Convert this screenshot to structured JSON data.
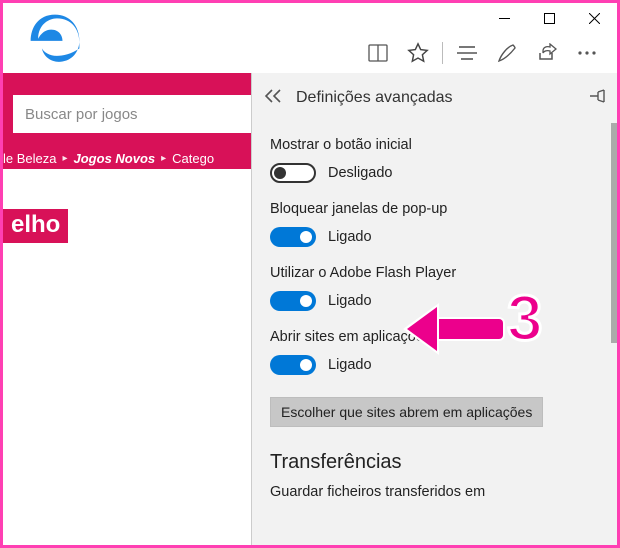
{
  "toolbar_icons": {
    "reading_list": "reading-list-icon",
    "favorites": "star-icon",
    "hub": "lines-icon",
    "notes": "pen-icon",
    "share": "share-icon",
    "more": "more-icon"
  },
  "page": {
    "search_placeholder": "Buscar por jogos",
    "nav": {
      "item1": "le Beleza",
      "item2": "Jogos Novos",
      "item3": "Catego"
    },
    "badge": "elho"
  },
  "panel": {
    "title": "Definições avançadas",
    "settings": [
      {
        "label": "Mostrar o botão inicial",
        "state_text": "Desligado",
        "on": false
      },
      {
        "label": "Bloquear janelas de pop-up",
        "state_text": "Ligado",
        "on": true
      },
      {
        "label": "Utilizar o Adobe Flash Player",
        "state_text": "Ligado",
        "on": true
      },
      {
        "label": "Abrir sites em aplicações",
        "state_text": "Ligado",
        "on": true
      }
    ],
    "choose_button": "Escolher que sites abrem em aplicações",
    "section_heading": "Transferências",
    "sub_line": "Guardar ficheiros transferidos em"
  },
  "annotation": {
    "number": "3"
  }
}
